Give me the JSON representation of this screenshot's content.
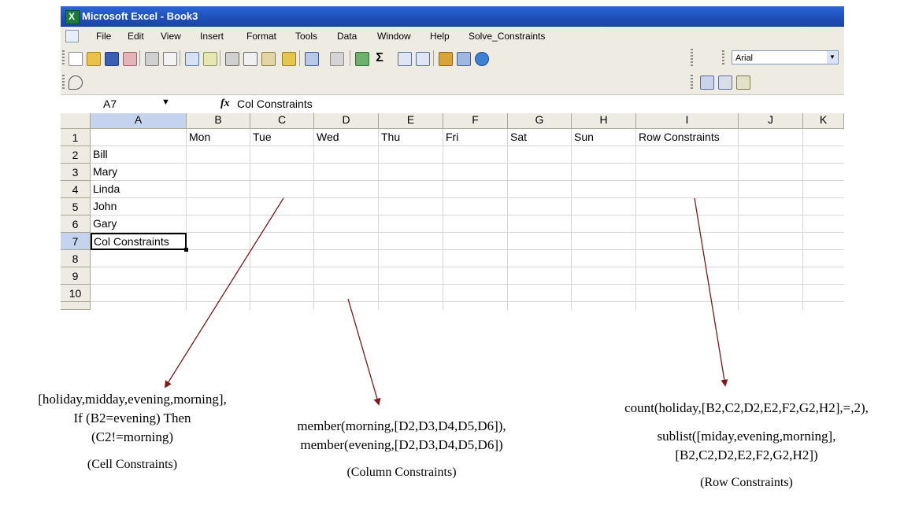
{
  "window": {
    "title": "Microsoft Excel - Book3",
    "menus": [
      "File",
      "Edit",
      "View",
      "Insert",
      "Format",
      "Tools",
      "Data",
      "Window",
      "Help",
      "Solve_Constraints"
    ],
    "font_name": "Arial"
  },
  "formula_bar": {
    "name_box": "A7",
    "fx": "fx",
    "content": "Col Constraints"
  },
  "sheet": {
    "columns": [
      "A",
      "B",
      "C",
      "D",
      "E",
      "F",
      "G",
      "H",
      "I",
      "J",
      "K"
    ],
    "row_numbers": [
      "1",
      "2",
      "3",
      "4",
      "5",
      "6",
      "7",
      "8",
      "9",
      "10"
    ],
    "row1": [
      "",
      "Mon",
      "Tue",
      "Wed",
      "Thu",
      "Fri",
      "Sat",
      "Sun",
      "Row Constraints",
      "",
      ""
    ],
    "names": [
      "Bill",
      "Mary",
      "Linda",
      "John",
      "Gary",
      "Col Constraints"
    ]
  },
  "annotations": {
    "cell": {
      "lines": [
        "[holiday,midday,evening,morning],",
        "If (B2=evening) Then",
        "(C2!=morning)"
      ],
      "caption": "(Cell Constraints)"
    },
    "column": {
      "lines": [
        "member(morning,[D2,D3,D4,D5,D6]),",
        "member(evening,[D2,D3,D4,D5,D6])"
      ],
      "caption": "(Column Constraints)"
    },
    "row": {
      "lines": [
        "count(holiday,[B2,C2,D2,E2,F2,G2,H2],=,2),",
        "sublist([miday,evening,morning],",
        "[B2,C2,D2,E2,F2,G2,H2])"
      ],
      "caption": "(Row Constraints)"
    }
  },
  "colors": {
    "titlebar": "#1f4fb8",
    "arrow": "#7a1a1a",
    "selected_header": "#c5d3ef"
  }
}
